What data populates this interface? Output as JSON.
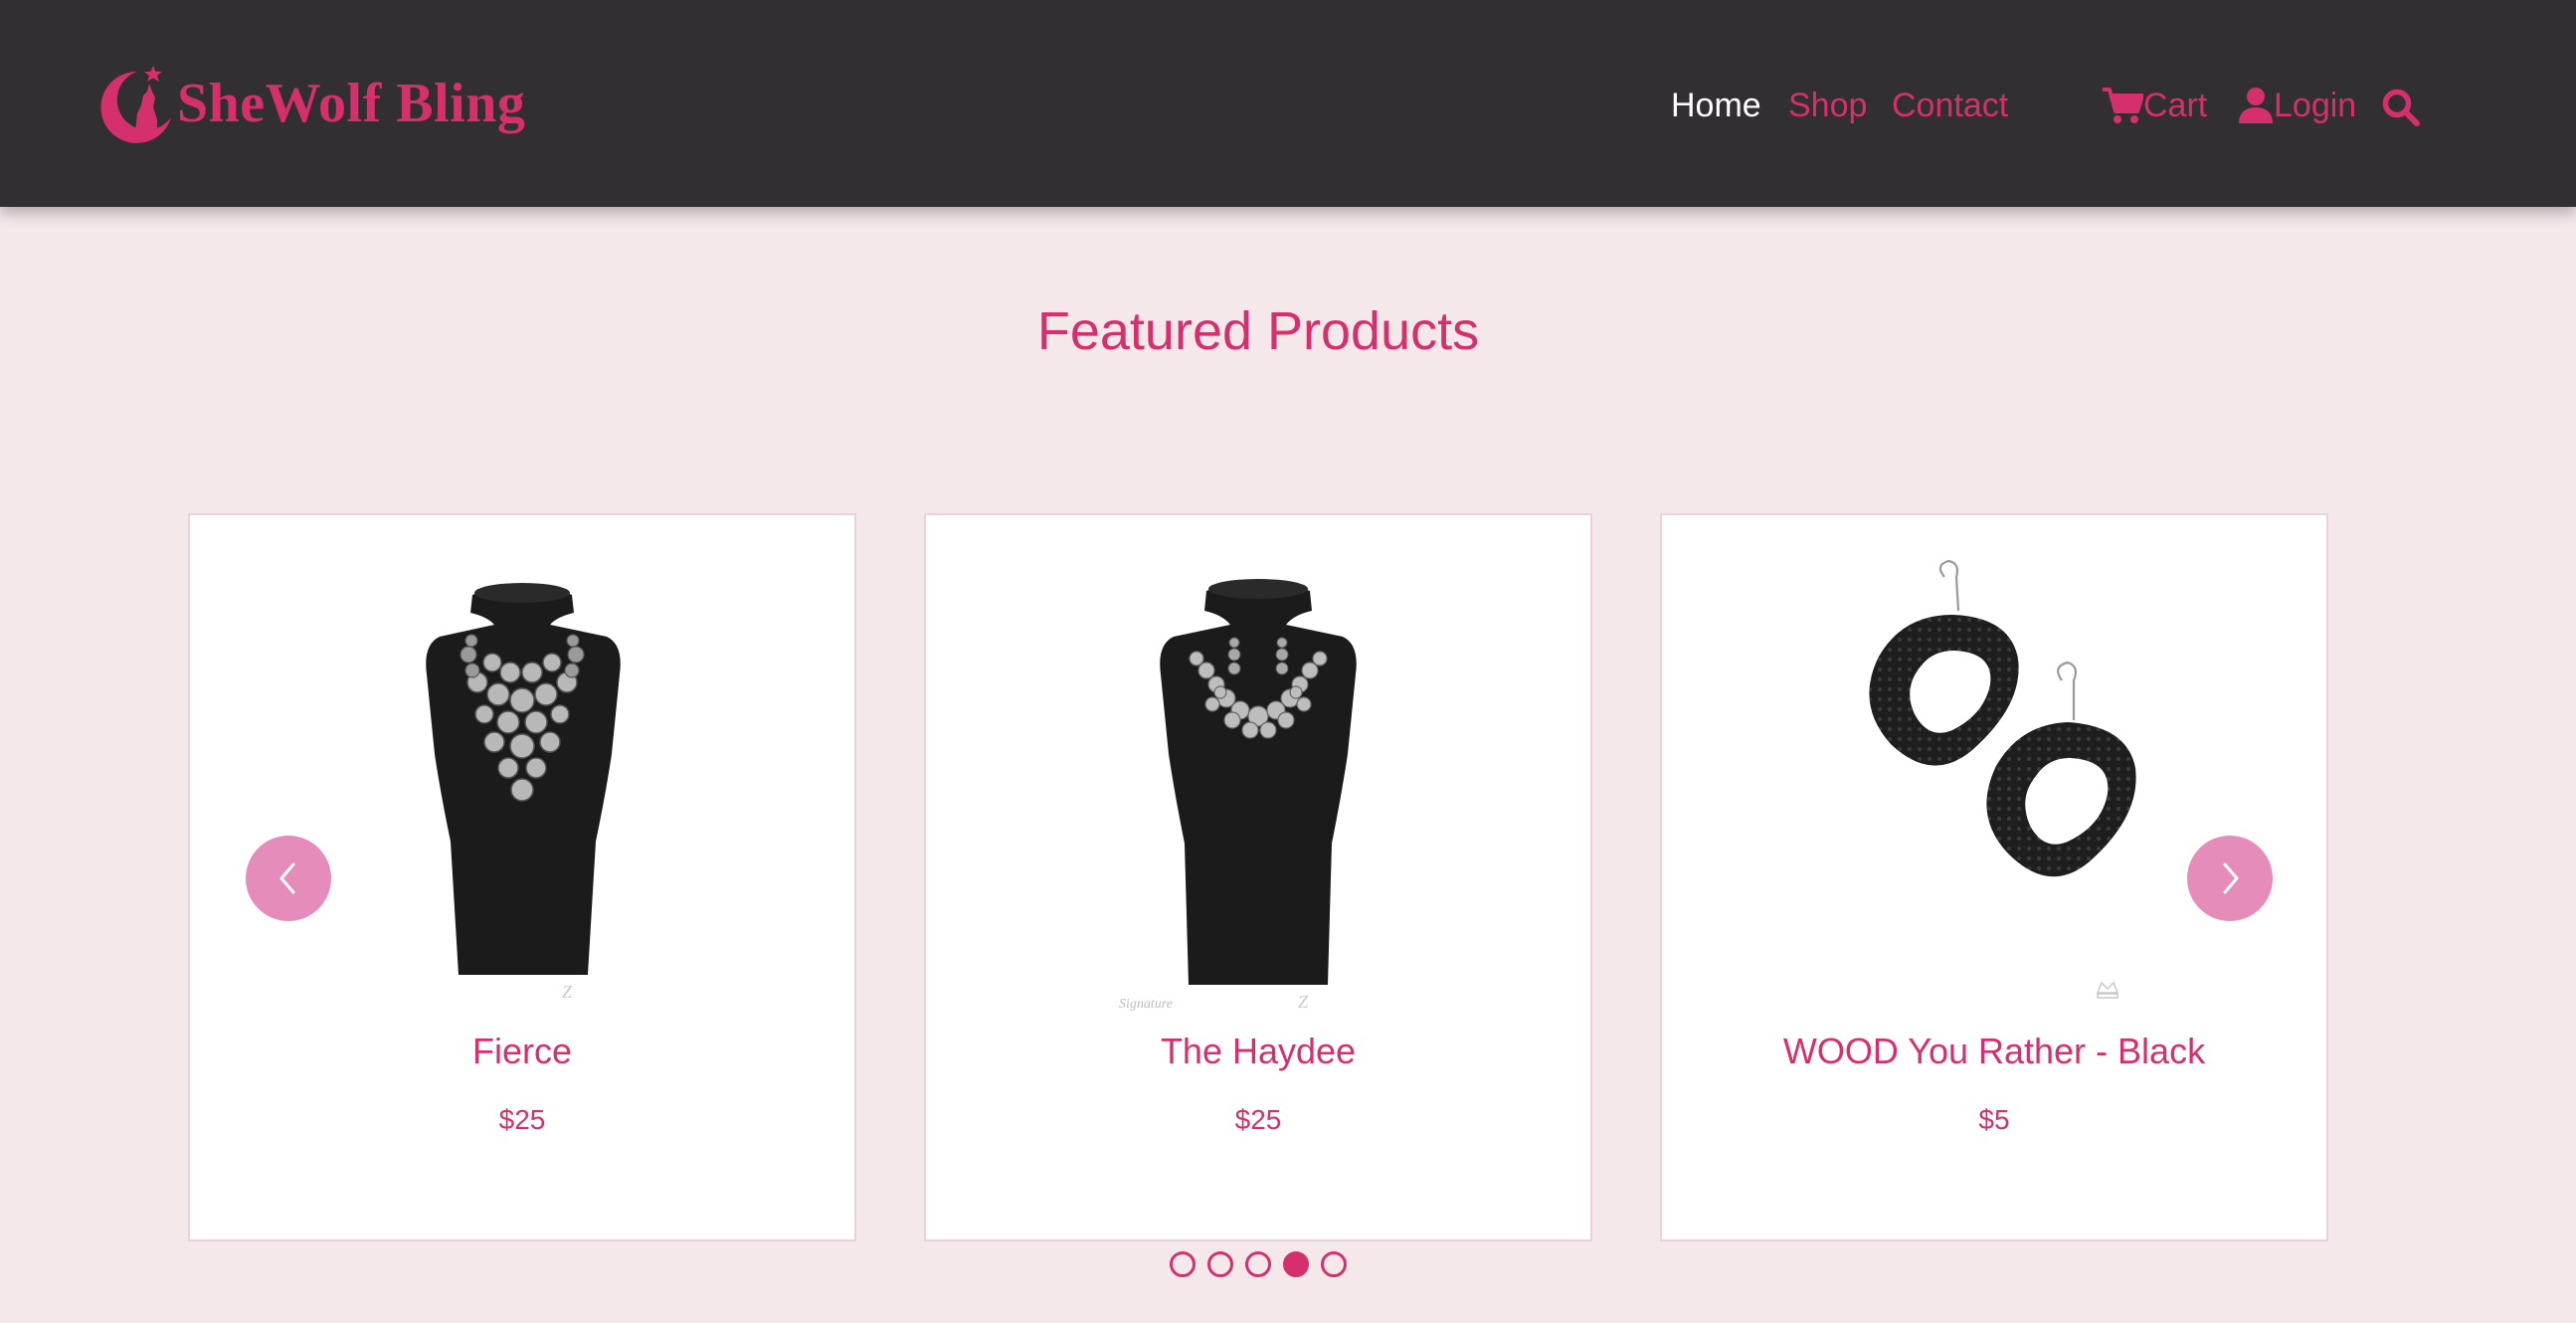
{
  "brand": {
    "name": "SheWolf Bling",
    "color": "#d62f6d"
  },
  "nav": {
    "home": "Home",
    "shop": "Shop",
    "contact": "Contact",
    "cart": "Cart",
    "login": "Login",
    "icons": {
      "cart": "shopping-cart-icon",
      "login": "user-icon",
      "search": "search-icon"
    }
  },
  "featured": {
    "title": "Featured Products",
    "products": [
      {
        "name": "Fierce",
        "price": "$25",
        "image": "necklace-on-bust"
      },
      {
        "name": "The Haydee",
        "price": "$25",
        "image": "necklace-on-bust"
      },
      {
        "name": "WOOD You Rather - Black",
        "price": "$5",
        "image": "black-wood-earrings"
      }
    ],
    "carousel": {
      "prev": "chevron-left-icon",
      "next": "chevron-right-icon",
      "slides": 5,
      "active_index": 3
    }
  },
  "colors": {
    "header_bg": "#312f31",
    "page_bg": "#f4e8eb",
    "accent": "#d62f6d",
    "arrow_bg": "#e58cbb"
  }
}
